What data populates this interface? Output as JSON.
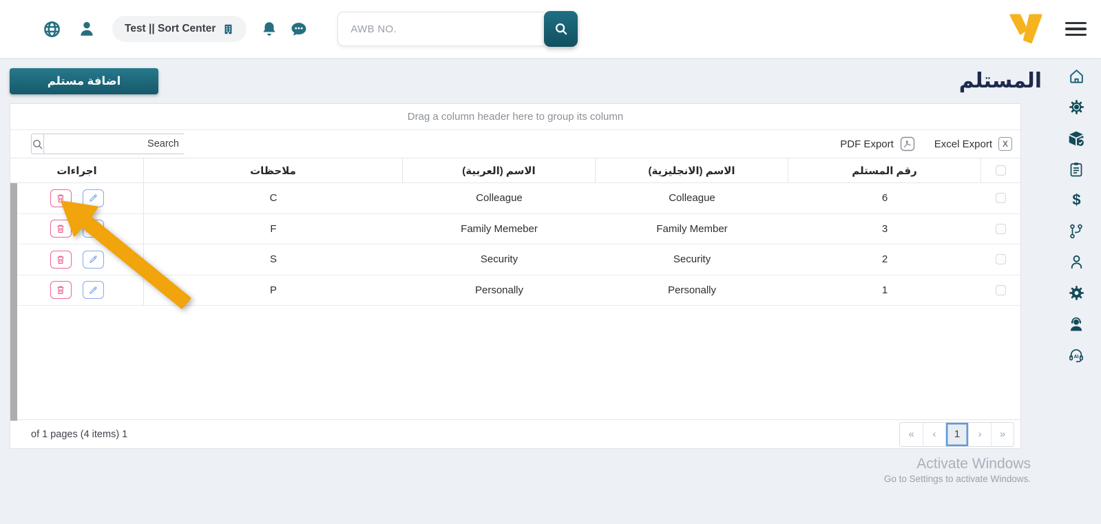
{
  "topbar": {
    "workspace_badge": "Test || Sort Center",
    "search_placeholder": "AWB NO."
  },
  "page": {
    "title": "المستلم",
    "add_button_label": "اضافة مستلم"
  },
  "grid": {
    "group_hint": "Drag a column header here to group its column",
    "search_placeholder": "Search",
    "pdf_export_label": "PDF Export",
    "excel_export_label": "Excel Export",
    "excel_icon_letter": "X",
    "columns": [
      "اجراءات",
      "ملاحظات",
      "الاسم (العربية)",
      "الاسم (الانجليزية)",
      "رقم المستلم"
    ],
    "rows": [
      {
        "notes": "C",
        "name_ar": "Colleague",
        "name_en": "Colleague",
        "number": "6"
      },
      {
        "notes": "F",
        "name_ar": "Family Memeber",
        "name_en": "Family Member",
        "number": "3"
      },
      {
        "notes": "S",
        "name_ar": "Security",
        "name_en": "Security",
        "number": "2"
      },
      {
        "notes": "P",
        "name_ar": "Personally",
        "name_en": "Personally",
        "number": "1"
      }
    ],
    "pager": {
      "summary": "of 1 pages (4 items) 1",
      "first": "«",
      "prev": "‹",
      "current_page": "1",
      "next": "›",
      "last": "»"
    }
  },
  "sidebar": {
    "ai_label": "AI",
    "finance_symbol": "$",
    "icons": [
      "home-icon",
      "gear-new-badge-icon",
      "package-check-icon",
      "clipboard-icon",
      "finance-dollar-icon",
      "workflow-branch-icon",
      "user-icon",
      "settings-gear-icon",
      "support-agent-icon",
      "ai-assistant-headset-icon"
    ]
  },
  "watermark": {
    "line1": "Activate Windows",
    "line2": "Go to Settings to activate Windows."
  },
  "annotation": {
    "shape": "arrow",
    "color": "#F1A40B",
    "target": "first-row-delete-button"
  },
  "colors": {
    "brand_teal": "#1D6577",
    "sidebar_icon": "#134B59",
    "logo_yellow": "#F4B31F",
    "title_navy": "#1E2A4E",
    "delete_pink": "#E85C87",
    "edit_blue": "#7AA0E8",
    "pager_active_border": "#5F9BDC",
    "arrow_orange": "#F1A40B",
    "page_background": "#EDF0F5"
  }
}
